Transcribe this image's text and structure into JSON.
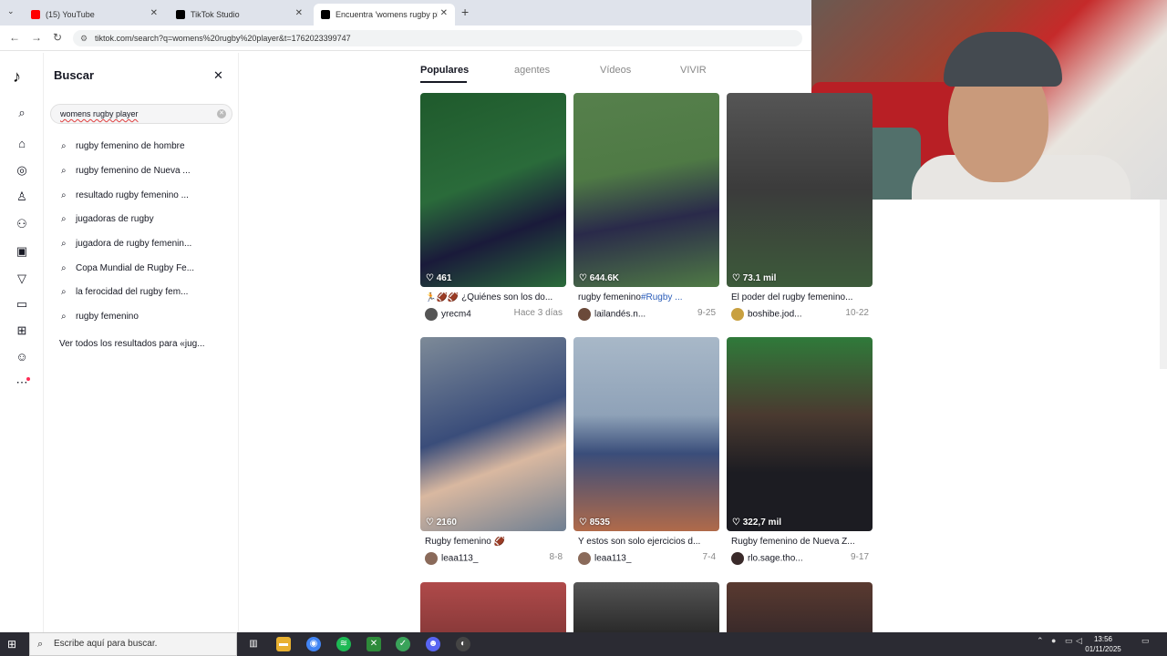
{
  "browser": {
    "tabs": [
      {
        "label": "(15) YouTube",
        "color": "#ff0000"
      },
      {
        "label": "TikTok Studio",
        "color": "#000000"
      },
      {
        "label": "Encuentra 'womens rugby playe",
        "color": "#000000"
      }
    ],
    "url": "tiktok.com/search?q=womens%20rugby%20player&t=1762023399747"
  },
  "search_panel": {
    "title": "Buscar",
    "query": "womens rugby player",
    "suggestions": [
      "rugby femenino de hombre",
      "rugby femenino de Nueva ...",
      "resultado rugby femenino ...",
      "jugadoras de rugby",
      "jugadora de rugby femenin...",
      "Copa Mundial de Rugby Fe...",
      "la ferocidad del rugby fem...",
      "rugby femenino"
    ],
    "see_all": "Ver todos los resultados para «jug..."
  },
  "content_tabs": [
    "Populares",
    "agentes",
    "Vídeos",
    "VIVIR"
  ],
  "videos": [
    {
      "likes": "461",
      "caption": "🏃🏈🏈 ¿Quiénes son los do...",
      "author": "yrecm4",
      "date": "Hace 3 días",
      "thumb": "#2a6b3a",
      "avatar": "#555555"
    },
    {
      "likes": "644.6K",
      "caption": "rugby femenino",
      "tag": "#Rugby ...",
      "author": "lailandés.n...",
      "date": "9-25",
      "thumb": "#4f7a45",
      "avatar": "#6b4a3a"
    },
    {
      "likes": "73.1 mil",
      "caption": "El poder del rugby femenino...",
      "author": "boshibe.jod...",
      "date": "10-22",
      "thumb": "#3b3b3b",
      "avatar": "#c8a040"
    },
    {
      "likes": "2160",
      "caption": "Rugby femenino 🏈",
      "author": "leaa113_",
      "date": "8-8",
      "thumb": "#6f7f92",
      "avatar": "#8a6a5a"
    },
    {
      "likes": "8535",
      "caption": "Y estos son solo ejercicios d...",
      "author": "leaa113_",
      "date": "7-4",
      "thumb": "#8fa2b8",
      "avatar": "#8a6a5a"
    },
    {
      "likes": "322,7 mil",
      "caption": "Rugby femenino de Nueva Z...",
      "author": "rlo.sage.tho...",
      "date": "9-17",
      "thumb": "#2f7a3a",
      "avatar": "#3a2a2a"
    }
  ],
  "row3_thumbs": [
    "#8a3a3a",
    "#2a2a2a",
    "#3a2a2a"
  ],
  "taskbar": {
    "search_placeholder": "Escribe aquí para buscar.",
    "time": "13:56",
    "date": "01/11/2025"
  }
}
